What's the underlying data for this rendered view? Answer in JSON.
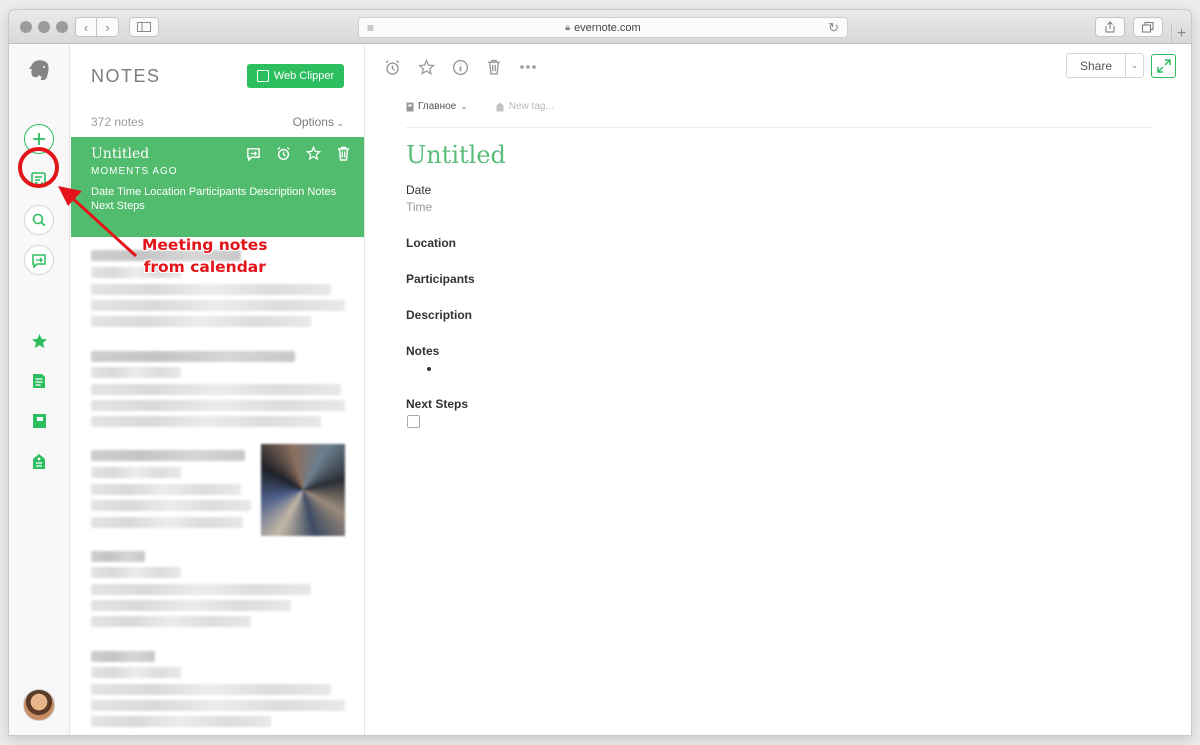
{
  "browser": {
    "url": "evernote.com"
  },
  "notes": {
    "title": "NOTES",
    "web_clipper_label": "Web Clipper",
    "count": "372 notes",
    "options_label": "Options",
    "active_note": {
      "title": "Untitled",
      "time": "MOMENTS AGO",
      "snippet": "Date Time Location Participants Description Notes Next Steps"
    }
  },
  "editor": {
    "share_label": "Share",
    "notebook": "Главное",
    "tag_placeholder": "New tag...",
    "title": "Untitled",
    "fields": {
      "date": "Date",
      "time": "Time",
      "location": "Location",
      "participants": "Participants",
      "description": "Description",
      "notes": "Notes",
      "next_steps": "Next Steps"
    }
  },
  "annotation": {
    "line1": "Meeting notes",
    "line2": "from calendar",
    "color": "#e3151a"
  },
  "colors": {
    "accent": "#2dbe60",
    "active_note_bg": "#51bc6d",
    "title_green": "#5bbd7b"
  },
  "icons": {
    "rail": [
      "elephant-logo-icon",
      "new-note-icon",
      "meeting-note-icon",
      "search-icon",
      "work-chat-icon",
      "shortcuts-star-icon",
      "notes-icon",
      "notebooks-icon",
      "tags-icon"
    ],
    "editor_toolbar": [
      "reminder-icon",
      "star-icon",
      "info-icon",
      "trash-icon",
      "more-icon"
    ]
  }
}
